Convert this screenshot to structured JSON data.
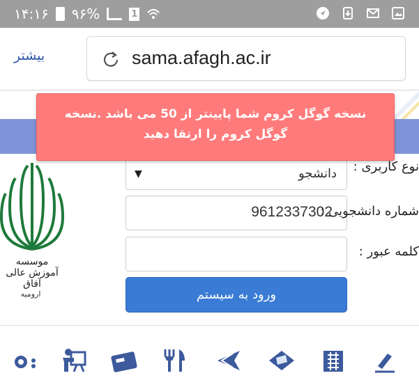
{
  "status_bar": {
    "time": "۱۴:۱۶",
    "battery": "۹۶%",
    "sim": "1"
  },
  "browser": {
    "url": "sama.afagh.ac.ir",
    "more_label": "بیشتر"
  },
  "toast": {
    "message": "نسخه گوگل کروم شما پایینتر از 50 می باشد .نسخه گوگل کروم را ارتقا دهید"
  },
  "login_form": {
    "user_type_label": "نوع کاربری :",
    "user_type_value": "دانشجو",
    "student_id_label": "شماره دانشجویی :",
    "student_id_value": "9612337302",
    "password_label": "کلمه عبور :",
    "password_value": "",
    "submit_label": "ورود به سیستم"
  },
  "logo": {
    "caption": "موسسه آموزش عالی آفاق",
    "sub": "ارومیه"
  },
  "icon_bar": {
    "icons": [
      "settings-icon",
      "presentation-icon",
      "bank-card-icon",
      "restaurant-icon",
      "back-arrow-icon",
      "sms-icon",
      "building-icon",
      "edit-icon"
    ]
  },
  "colors": {
    "status_bar": "#9e9e9e",
    "toast": "#ff7b7b",
    "button": "#3a7bd5",
    "icon": "#3c5a9c",
    "logo": "#1e7a3a",
    "band": "#7f93d8"
  }
}
